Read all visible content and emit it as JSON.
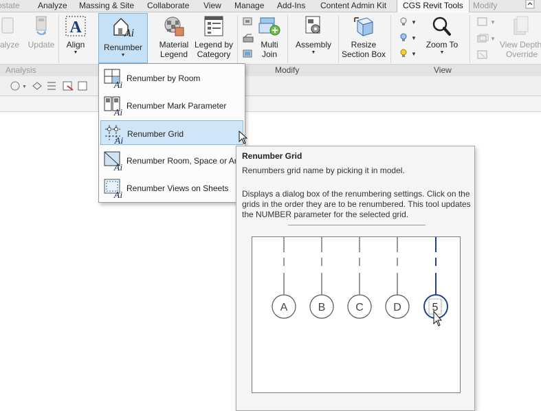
{
  "tabs": [
    {
      "label": "ostate",
      "faded": true
    },
    {
      "label": "Analyze"
    },
    {
      "label": "Massing & Site"
    },
    {
      "label": "Collaborate"
    },
    {
      "label": "View"
    },
    {
      "label": "Manage"
    },
    {
      "label": "Add-Ins"
    },
    {
      "label": "Content Admin Kit"
    },
    {
      "label": "CGS Revit Tools",
      "active": true
    },
    {
      "label": "Modify"
    }
  ],
  "window_control_icon": "restore-caret-icon",
  "ribbon": {
    "analyze_label": "alyze",
    "update_label": "Update",
    "align_label": "Align",
    "renumber_label": "Renumber",
    "material_legend_label": [
      "Material",
      "Legend"
    ],
    "legend_by_category_label": [
      "Legend by",
      "Category"
    ],
    "multi_join_label": [
      "Multi",
      "Join"
    ],
    "assembly_label": "Assembly",
    "resize_section_label": [
      "Resize",
      "Section Box"
    ],
    "zoom_to_label": "Zoom To",
    "view_depth_label": [
      "View Depth",
      "Override"
    ],
    "panels": {
      "analysis": "Analysis",
      "modify": "Modify",
      "view": "View"
    }
  },
  "menu": {
    "items": [
      {
        "label": "Renumber by Room",
        "icon": "renumber-room-icon"
      },
      {
        "label": "Renumber Mark Parameter",
        "icon": "renumber-mark-icon"
      },
      {
        "label": "Renumber Grid",
        "icon": "renumber-grid-icon",
        "highlighted": true
      },
      {
        "label": "Renumber Room, Space or Area",
        "icon": "renumber-room-space-icon"
      },
      {
        "label": "Renumber Views on Sheets",
        "icon": "renumber-views-icon"
      }
    ]
  },
  "tooltip": {
    "title": "Renumber Grid",
    "description": "Renumbers grid name by picking it in model.",
    "detail": "Displays a dialog box of the renumbering settings. Click on the grids in the order they are to be renumbered. This tool updates the NUMBER parameter for the selected grid.",
    "grid_labels": [
      "A",
      "B",
      "C",
      "D",
      "5"
    ]
  },
  "colors": {
    "accent": "#7eb4e2",
    "highlight": "#cfe6f8",
    "grid_selected": "#1f3f9a"
  }
}
